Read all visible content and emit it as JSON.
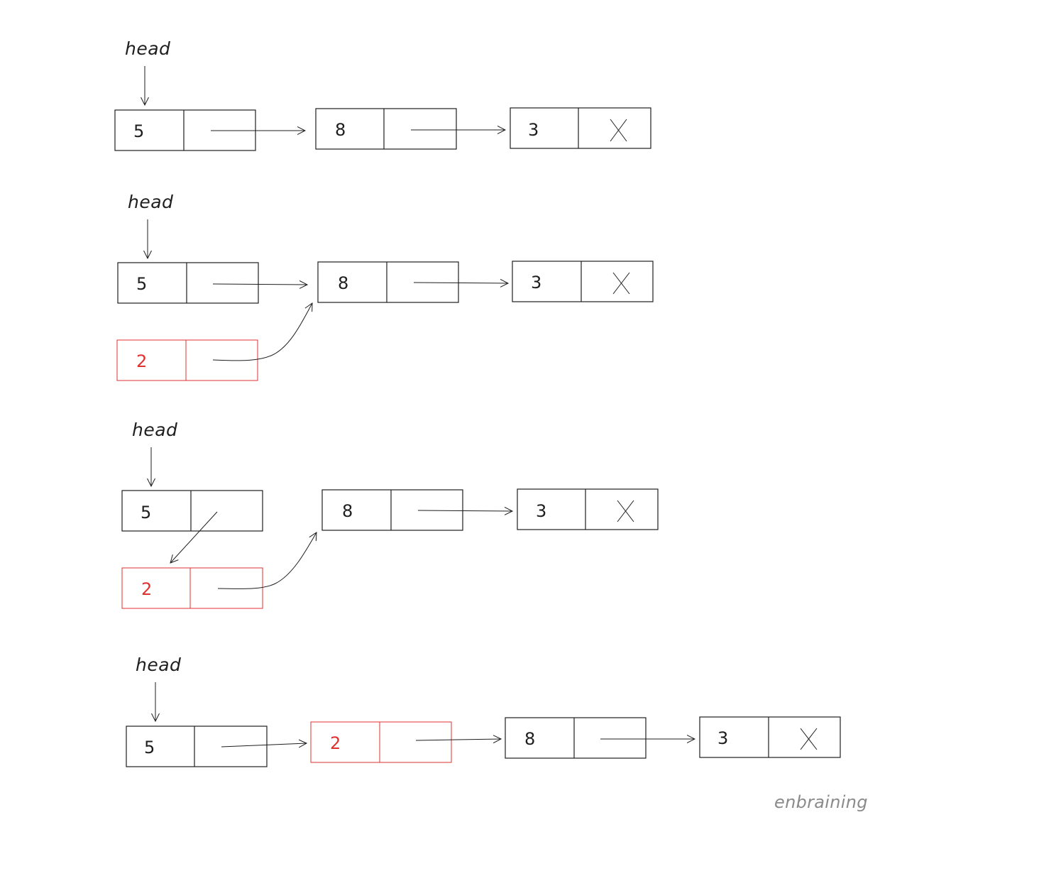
{
  "head_label": "head",
  "values": {
    "node_5": "5",
    "node_8": "8",
    "node_3": "3",
    "node_2": "2"
  },
  "null_marker": "X",
  "colors": {
    "ink": "#1e1e1e",
    "new_node": "#e03131",
    "watermark": "#8a8a8a"
  },
  "watermark": "enbraining"
}
